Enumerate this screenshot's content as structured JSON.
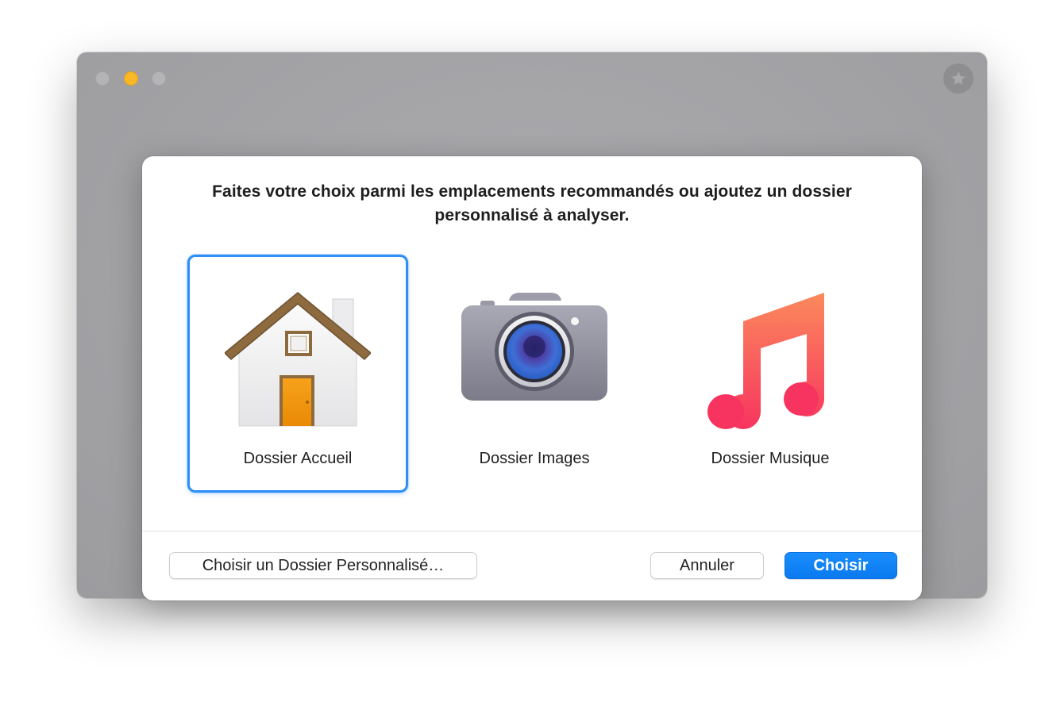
{
  "dialog": {
    "title_line1": "Faites votre choix parmi les emplacements recommandés ou ajoutez un dossier",
    "title_line2": "personnalisé à analyser.",
    "locations": [
      {
        "label": "Dossier Accueil",
        "icon": "home-folder-icon",
        "selected": true
      },
      {
        "label": "Dossier Images",
        "icon": "camera-icon",
        "selected": false
      },
      {
        "label": "Dossier Musique",
        "icon": "music-note-icon",
        "selected": false
      }
    ],
    "buttons": {
      "custom_label": "Choisir un Dossier Personnalisé…",
      "cancel_label": "Annuler",
      "choose_label": "Choisir"
    }
  },
  "colors": {
    "accent": "#0a84ff",
    "selection_border": "#2f8ff6",
    "minimize": "#f8b827",
    "window_bg": "#a5a5a8"
  }
}
